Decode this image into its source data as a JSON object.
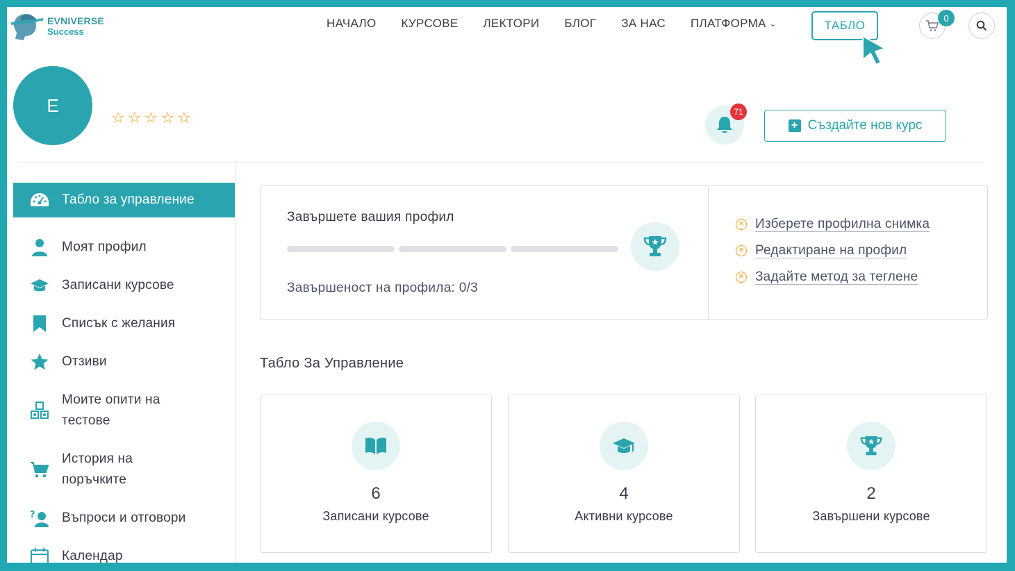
{
  "brand": {
    "line1": "EVNIVERSE",
    "line2": "Success"
  },
  "nav": {
    "items": [
      "НАЧАЛО",
      "КУРСОВЕ",
      "ЛЕКТОРИ",
      "БЛОГ",
      "ЗА НАС"
    ],
    "platform": "ПЛАТФОРМА",
    "tablo": "ТАБЛО"
  },
  "cart": {
    "count": "0"
  },
  "profile": {
    "initial": "E",
    "rating": 0,
    "rating_max": 5
  },
  "notifications": {
    "count": "71"
  },
  "create_course": "Създайте нов курс",
  "sidebar": {
    "items": [
      {
        "label": "Табло за управление",
        "icon": "dashboard-icon"
      },
      {
        "label": "Моят профил",
        "icon": "user-icon"
      },
      {
        "label": "Записани курсове",
        "icon": "graduation-cap-icon"
      },
      {
        "label": "Списък с желания",
        "icon": "bookmark-icon"
      },
      {
        "label": "Отзиви",
        "icon": "star-icon"
      },
      {
        "label": "Моите опити на тестове",
        "line1": "Моите опити на",
        "line2": "тестове",
        "icon": "shapes-icon"
      },
      {
        "label": "История на поръчките",
        "line1": "История на",
        "line2": "поръчките",
        "icon": "cart-icon"
      },
      {
        "label": "Въпроси и отговори",
        "icon": "question-answer-icon"
      },
      {
        "label": "Календар",
        "icon": "calendar-icon"
      }
    ]
  },
  "profile_completion": {
    "title": "Завършете вашия профил",
    "status": "Завършеност на профила: 0/3",
    "steps_done": 0,
    "steps_total": 3,
    "links": [
      "Изберете профилна снимка",
      "Редактиране на профил",
      "Задайте метод за теглене"
    ]
  },
  "dashboard": {
    "title": "Табло За Управление",
    "stats": [
      {
        "value": "6",
        "label": "Записани курсове",
        "icon": "book-icon"
      },
      {
        "value": "4",
        "label": "Активни курсове",
        "icon": "graduation-cap-icon"
      },
      {
        "value": "2",
        "label": "Завършени курсове",
        "icon": "trophy-icon"
      }
    ]
  },
  "colors": {
    "accent": "#2aa5b0",
    "star": "#f0a020",
    "badge": "#e5343a"
  }
}
